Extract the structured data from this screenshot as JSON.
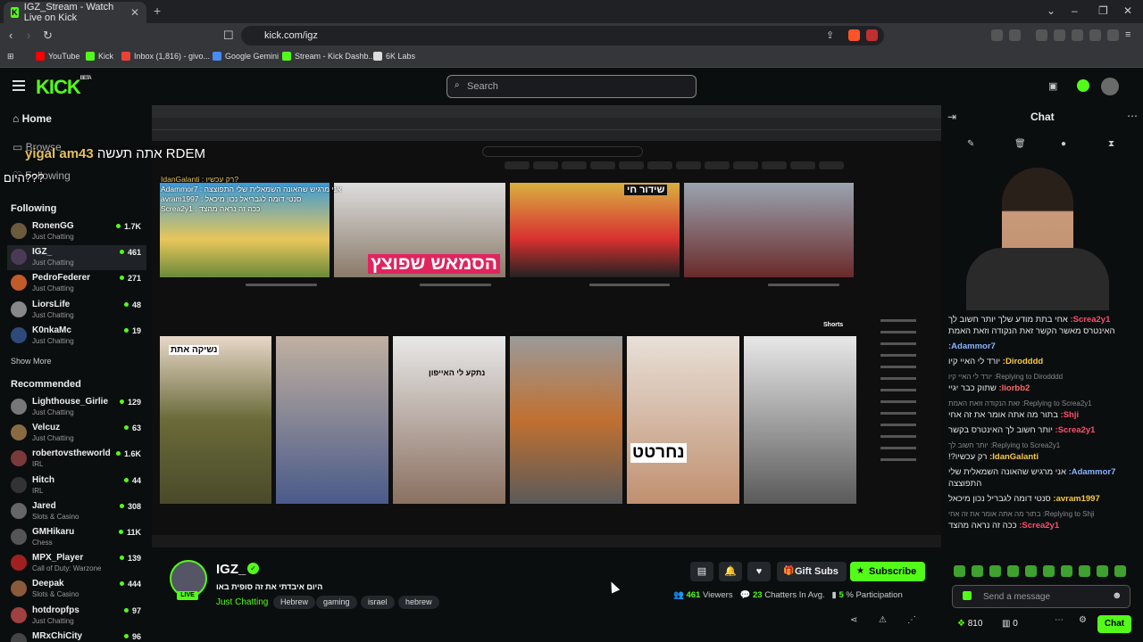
{
  "browser": {
    "tab_title": "IGZ_Stream - Watch Live on Kick",
    "url": "kick.com/igz",
    "bookmarks": [
      "YouTube",
      "Kick",
      "Inbox (1,816) - givo...",
      "Google Gemini",
      "Stream - Kick Dashb...",
      "6K Labs"
    ]
  },
  "kick": {
    "logo": "KICK",
    "logo_badge": "BETA",
    "search_placeholder": "Search"
  },
  "sidebar": {
    "nav": [
      "Home",
      "Browse",
      "Following"
    ],
    "following_title": "Following",
    "following": [
      {
        "name": "RonenGG",
        "category": "Just Chatting",
        "viewers": "1.7K",
        "color": "#6b5b3c"
      },
      {
        "name": "IGZ_",
        "category": "Just Chatting",
        "viewers": "461",
        "color": "#4a3a55"
      },
      {
        "name": "PedroFederer",
        "category": "Just Chatting",
        "viewers": "271",
        "color": "#c25a2a"
      },
      {
        "name": "LiorsLife",
        "category": "Just Chatting",
        "viewers": "48",
        "color": "#888"
      },
      {
        "name": "K0nkaMc",
        "category": "Just Chatting",
        "viewers": "19",
        "color": "#2d4a7a"
      }
    ],
    "show_more": "Show More",
    "recommended_title": "Recommended",
    "recommended": [
      {
        "name": "Lighthouse_Girlie",
        "category": "Just Chatting",
        "viewers": "129",
        "color": "#777"
      },
      {
        "name": "Velcuz",
        "category": "Just Chatting",
        "viewers": "63",
        "color": "#8a6a40"
      },
      {
        "name": "robertovstheworld",
        "category": "IRL",
        "viewers": "1.6K",
        "color": "#7a3a3a"
      },
      {
        "name": "Hitch",
        "category": "IRL",
        "viewers": "44",
        "color": "#333"
      },
      {
        "name": "Jared",
        "category": "Slots & Casino",
        "viewers": "308",
        "color": "#666"
      },
      {
        "name": "GMHikaru",
        "category": "Chess",
        "viewers": "11K",
        "color": "#555"
      },
      {
        "name": "MPX_Player",
        "category": "Call of Duty: Warzone",
        "viewers": "139",
        "color": "#a02020"
      },
      {
        "name": "Deepak",
        "category": "Slots & Casino",
        "viewers": "444",
        "color": "#8a5a3a"
      },
      {
        "name": "hotdropfps",
        "category": "Just Chatting",
        "viewers": "97",
        "color": "#a04040"
      },
      {
        "name": "MRxChiCity",
        "category": "",
        "viewers": "96",
        "color": "#444"
      }
    ]
  },
  "overlay": {
    "user": "yigal am43",
    "text": "אתה תעשה RDEM",
    "question": "היום???"
  },
  "chat": {
    "title": "Chat",
    "messages": [
      {
        "user": "Screa2y1:",
        "text": "אחי בתת מודע שלך יותר חשוב לך האינטרס מאשר הקשר זאת הנקודה וזאת האמת",
        "color": "#ff4d6d"
      },
      {
        "user": "Adammor7:",
        "text": "",
        "color": "#8ab4ff"
      },
      {
        "user": "Dirodddd:",
        "text": "יורד לי האיי קיו",
        "color": "#f7c948"
      },
      {
        "reply": "Replying to Dirodddd: יורד לי האיי קיו"
      },
      {
        "user": "liorbb2:",
        "text": "שתוק כבר יגיי",
        "color": "#ff6b6b"
      },
      {
        "reply": "Replying to Screa2y1: זאת הנקודה וזאת האמת"
      },
      {
        "user": "Shji:",
        "text": "בתור מה אתה אומר את זה אחי",
        "color": "#ff4d6d"
      },
      {
        "user": "Screa2y1:",
        "text": "יותר חשוב לך האינטרס בקשר",
        "color": "#ff4d6d"
      },
      {
        "reply": "Replying to Screa2y1: יותר חשוב לך"
      },
      {
        "user": "IdanGalanti:",
        "text": "רק עכשיו?!",
        "color": "#f7c948"
      },
      {
        "user": "Adammor7:",
        "text": "אני מרגיש שהאונה השמאלית שלי התפוצצה",
        "color": "#8ab4ff"
      },
      {
        "user": "avram1997:",
        "text": "סנטי דומה לגבריל נכון מיכאל",
        "color": "#f7c948"
      },
      {
        "reply": "Replying to Shji: בתור מה אתה אומר את זה אחי"
      },
      {
        "user": "Screa2y1:",
        "text": "ככה זה נראה מהצד",
        "color": "#ff4d6d"
      }
    ],
    "send_placeholder": "Send a message",
    "points": "810",
    "zero": "0",
    "chat_button": "Chat"
  },
  "stream": {
    "name": "IGZ_",
    "title": "היום איבדתי את זה סופית באו",
    "category": "Just Chatting",
    "tags": [
      "Hebrew",
      "gaming",
      "israel",
      "hebrew"
    ],
    "live_label": "LIVE",
    "gift_label": "Gift Subs",
    "subscribe_label": "Subscribe",
    "viewers": "461",
    "viewers_label": "Viewers",
    "chatters": "23",
    "chatters_label": "Chatters In Avg.",
    "participation": "5",
    "participation_label": "% Participation"
  },
  "video": {
    "thumb_text_1": "הסמאש שפוצץ",
    "thumb_text_2": "שידור חי",
    "shorts_label": "Shorts",
    "short_text_1": "נשיקה אתת",
    "short_text_2": "נתקע לי האייפון",
    "short_text_3": "נחרטט",
    "overlay_chat": [
      "IdanGalanti : רק עכשיו?",
      "Adammor7 : אני מרגיש שהאונה השמאלית שלי התפוצצה",
      "avram1997 : סנטי דומה לגבריאל נכון מיכאל",
      "Screa2y1 : ככה זה נראה מהצד"
    ]
  }
}
